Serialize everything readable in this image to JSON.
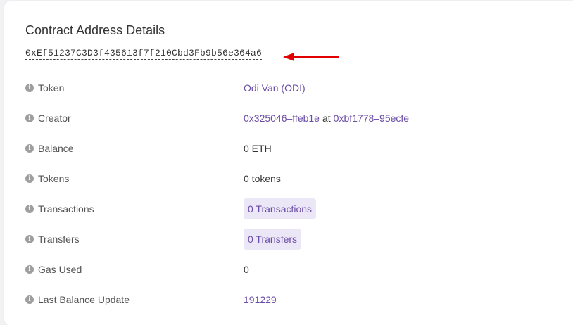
{
  "title": "Contract Address Details",
  "address": "0xEf51237C3D3f435613f7f210Cbd3Fb9b56e364a6",
  "colors": {
    "link": "#6a4ca6",
    "pill_bg": "#ece7f6",
    "arrow": "#e00000",
    "icon": "#9e9e9e"
  },
  "rows": {
    "token": {
      "label": "Token",
      "value": "Odi Van (ODI)"
    },
    "creator": {
      "label": "Creator",
      "address": "0x325046–ffeb1e",
      "at": "at",
      "tx": "0xbf1778–95ecfe"
    },
    "balance": {
      "label": "Balance",
      "value": "0 ETH"
    },
    "tokens": {
      "label": "Tokens",
      "value": "0 tokens"
    },
    "transactions": {
      "label": "Transactions",
      "value": "0 Transactions"
    },
    "transfers": {
      "label": "Transfers",
      "value": "0 Transfers"
    },
    "gas_used": {
      "label": "Gas Used",
      "value": "0"
    },
    "last_balance_update": {
      "label": "Last Balance Update",
      "value": "191229"
    }
  },
  "icons": {
    "info": "i",
    "arrow": "left-arrow"
  }
}
